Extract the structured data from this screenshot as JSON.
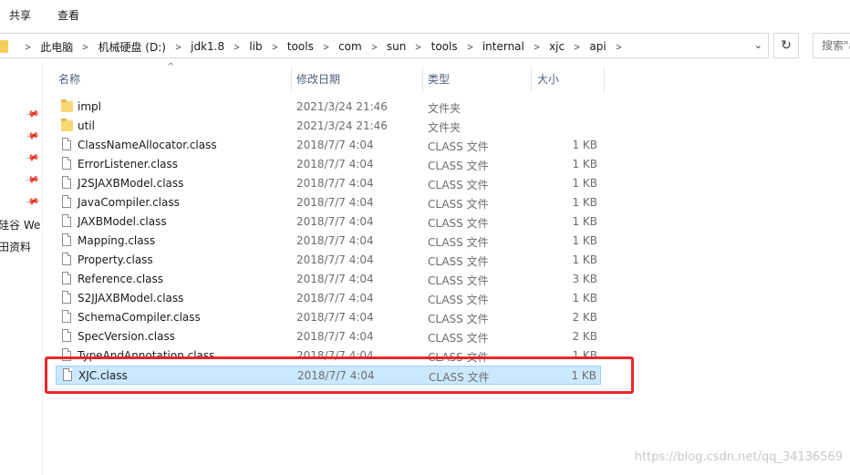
{
  "ribbon": {
    "tabs": [
      "共享",
      "查看"
    ]
  },
  "address": {
    "crumbs": [
      "此电脑",
      "机械硬盘 (D:)",
      "jdk1.8",
      "lib",
      "tools",
      "com",
      "sun",
      "tools",
      "internal",
      "xjc",
      "api"
    ]
  },
  "search": {
    "placeholder": "搜索\"a"
  },
  "nav": {
    "items": [
      "硅谷 We",
      "田资料"
    ]
  },
  "columns": {
    "name": "名称",
    "date": "修改日期",
    "type": "类型",
    "size": "大小"
  },
  "files": [
    {
      "name": "impl",
      "date": "2021/3/24 21:46",
      "type": "文件夹",
      "size": "",
      "kind": "folder-icon"
    },
    {
      "name": "util",
      "date": "2021/3/24 21:46",
      "type": "文件夹",
      "size": "",
      "kind": "folder-icon"
    },
    {
      "name": "ClassNameAllocator.class",
      "date": "2018/7/7 4:04",
      "type": "CLASS 文件",
      "size": "1 KB",
      "kind": "file-icon"
    },
    {
      "name": "ErrorListener.class",
      "date": "2018/7/7 4:04",
      "type": "CLASS 文件",
      "size": "1 KB",
      "kind": "file-icon"
    },
    {
      "name": "J2SJAXBModel.class",
      "date": "2018/7/7 4:04",
      "type": "CLASS 文件",
      "size": "1 KB",
      "kind": "file-icon"
    },
    {
      "name": "JavaCompiler.class",
      "date": "2018/7/7 4:04",
      "type": "CLASS 文件",
      "size": "1 KB",
      "kind": "file-icon"
    },
    {
      "name": "JAXBModel.class",
      "date": "2018/7/7 4:04",
      "type": "CLASS 文件",
      "size": "1 KB",
      "kind": "file-icon"
    },
    {
      "name": "Mapping.class",
      "date": "2018/7/7 4:04",
      "type": "CLASS 文件",
      "size": "1 KB",
      "kind": "file-icon"
    },
    {
      "name": "Property.class",
      "date": "2018/7/7 4:04",
      "type": "CLASS 文件",
      "size": "1 KB",
      "kind": "file-icon"
    },
    {
      "name": "Reference.class",
      "date": "2018/7/7 4:04",
      "type": "CLASS 文件",
      "size": "3 KB",
      "kind": "file-icon"
    },
    {
      "name": "S2JJAXBModel.class",
      "date": "2018/7/7 4:04",
      "type": "CLASS 文件",
      "size": "1 KB",
      "kind": "file-icon"
    },
    {
      "name": "SchemaCompiler.class",
      "date": "2018/7/7 4:04",
      "type": "CLASS 文件",
      "size": "2 KB",
      "kind": "file-icon"
    },
    {
      "name": "SpecVersion.class",
      "date": "2018/7/7 4:04",
      "type": "CLASS 文件",
      "size": "2 KB",
      "kind": "file-icon"
    },
    {
      "name": "TypeAndAnnotation.class",
      "date": "2018/7/7 4:04",
      "type": "CLASS 文件",
      "size": "1 KB",
      "kind": "file-icon"
    },
    {
      "name": "XJC.class",
      "date": "2018/7/7 4:04",
      "type": "CLASS 文件",
      "size": "1 KB",
      "kind": "file-icon",
      "selected": true
    }
  ],
  "watermark": "https://blog.csdn.net/qq_34136569",
  "colors": {
    "selection": "#cce8ff",
    "highlight": "#e8262a",
    "folder": "#f8d775"
  }
}
